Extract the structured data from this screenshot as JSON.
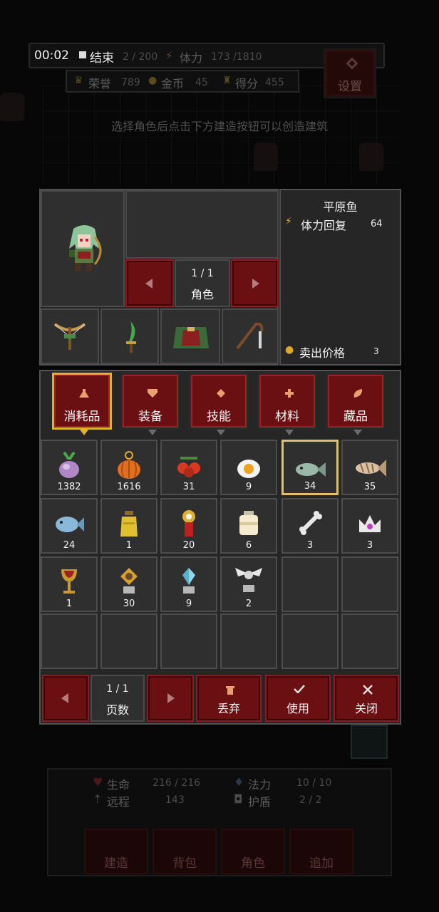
{
  "top": {
    "time": "00:02",
    "end_label": "结束",
    "wave": "2 / 200",
    "stamina_label": "体力",
    "stamina_value": "173 /1810",
    "honor_label": "荣誉",
    "honor_value": "789",
    "gold_label": "金币",
    "gold_value": "45",
    "score_label": "得分",
    "score_value": "455",
    "settings_label": "设置",
    "hint": "选择角色后点击下方建造按钮可以创造建筑"
  },
  "character": {
    "page": "1  /  1",
    "page_label": "角色",
    "equipment": [
      "crossbow-icon",
      "dagger-icon",
      "cloak-icon",
      "hook-staff-icon"
    ]
  },
  "detail": {
    "item_name": "平原鱼",
    "effect_label": "体力回复",
    "effect_value": "64",
    "sell_label": "卖出价格",
    "sell_value": "3"
  },
  "tabs": [
    {
      "label": "消耗品",
      "icon": "flask-icon",
      "active": true
    },
    {
      "label": "装备",
      "icon": "shield-icon",
      "active": false
    },
    {
      "label": "技能",
      "icon": "diamond-icon",
      "active": false
    },
    {
      "label": "材料",
      "icon": "plus-icon",
      "active": false
    },
    {
      "label": "藏品",
      "icon": "leaf-icon",
      "active": false
    }
  ],
  "items": [
    {
      "name": "turnip-icon",
      "count": "1382"
    },
    {
      "name": "pumpkin-icon",
      "count": "1616"
    },
    {
      "name": "berries-icon",
      "count": "31"
    },
    {
      "name": "fried-egg-icon",
      "count": "9"
    },
    {
      "name": "plain-fish-icon",
      "count": "34",
      "selected": true
    },
    {
      "name": "dried-fish-icon",
      "count": "35"
    },
    {
      "name": "blue-fish-icon",
      "count": "24"
    },
    {
      "name": "honey-jar-icon",
      "count": "1"
    },
    {
      "name": "medal-icon",
      "count": "20"
    },
    {
      "name": "milk-jar-icon",
      "count": "6"
    },
    {
      "name": "bone-icon",
      "count": "3"
    },
    {
      "name": "crown-icon",
      "count": "3"
    },
    {
      "name": "goblet-icon",
      "count": "1"
    },
    {
      "name": "gold-totem-icon",
      "count": "30"
    },
    {
      "name": "crystal-totem-icon",
      "count": "9"
    },
    {
      "name": "winged-totem-icon",
      "count": "2"
    }
  ],
  "pager": {
    "page": "1  /  1",
    "page_label": "页数",
    "discard_label": "丢弃",
    "use_label": "使用",
    "close_label": "关闭"
  },
  "hud": {
    "life_label": "生命",
    "life_value": "216 / 216",
    "mana_label": "法力",
    "mana_value": "10  /  10",
    "range_label": "远程",
    "range_value": "143",
    "shield_label": "护盾",
    "shield_value": "2  /  2",
    "build_label": "建造",
    "bag_label": "背包",
    "role_label": "角色",
    "add_label": "追加"
  },
  "colors": {
    "accent_red": "#6a0f12",
    "selection_gold": "#e2c06a",
    "panel_bg": "#262626"
  }
}
